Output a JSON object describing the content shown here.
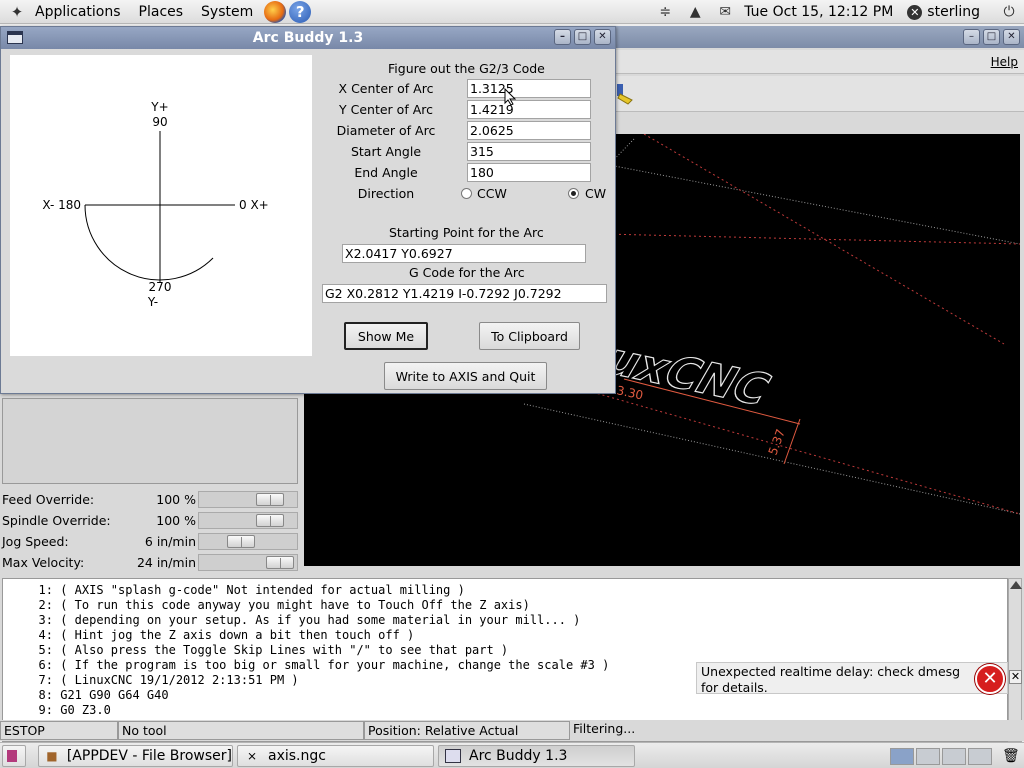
{
  "top_panel": {
    "menus": [
      "Applications",
      "Places",
      "System"
    ],
    "datetime": "Tue Oct 15, 12:12 PM",
    "user": "sterling"
  },
  "dialog": {
    "title": "Arc Buddy 1.3",
    "heading": "Figure out the G2/3 Code",
    "fields": [
      {
        "label": "X Center of Arc",
        "value": "1.3125"
      },
      {
        "label": "Y Center of Arc",
        "value": "1.4219"
      },
      {
        "label": "Diameter of Arc",
        "value": "2.0625"
      },
      {
        "label": "Start Angle",
        "value": "315"
      },
      {
        "label": "End Angle",
        "value": "180"
      }
    ],
    "direction_label": "Direction",
    "ccw_label": "CCW",
    "cw_label": "CW",
    "direction_selected": "CW",
    "starting_point_label": "Starting Point for the Arc",
    "starting_point_value": "X2.0417 Y0.6927",
    "gcode_label": "G Code for the Arc",
    "gcode_value": "G2 X0.2812 Y1.4219 I-0.7292 J0.7292",
    "show_me_label": "Show Me",
    "clipboard_label": "To Clipboard",
    "write_quit_label": "Write to AXIS and Quit",
    "canvas": {
      "y_plus": "Y+",
      "y_plus_angle": "90",
      "x_minus": "X- 180",
      "x_plus": "0 X+",
      "y_minus_angle": "270",
      "y_minus": "Y-",
      "arc_start_deg": 315,
      "arc_end_deg": 180
    }
  },
  "axis": {
    "help_menu": "Help",
    "preview_text": "LinuxCNC",
    "dim_labels": [
      "3.30",
      "5.37"
    ],
    "overrides": [
      {
        "label": "Feed Override:",
        "value": "100 %",
        "slider": 0.82
      },
      {
        "label": "Spindle Override:",
        "value": "100 %",
        "slider": 0.82
      },
      {
        "label": "Jog Speed:",
        "value": "6 in/min",
        "slider": 0.4
      },
      {
        "label": "Max Velocity:",
        "value": "24 in/min",
        "slider": 0.95
      }
    ],
    "code_lines": [
      {
        "num": "1:",
        "text": "( AXIS \"splash g-code\" Not intended for actual milling )"
      },
      {
        "num": "2:",
        "text": "( To run this code anyway you might have to Touch Off the Z axis)"
      },
      {
        "num": "3:",
        "text": "( depending on your setup. As if you had some material in your mill... )"
      },
      {
        "num": "4:",
        "text": "( Hint jog the Z axis down a bit then touch off )"
      },
      {
        "num": "5:",
        "text": "( Also press the Toggle Skip Lines with \"/\" to see that part )"
      },
      {
        "num": "6:",
        "text": "( If the program is too big or small for your machine, change the scale #3 )"
      },
      {
        "num": "7:",
        "text": "( LinuxCNC 19/1/2012 2:13:51 PM )"
      },
      {
        "num": "8:",
        "text": "G21 G90 G64 G40"
      },
      {
        "num": "9:",
        "text": "G0 Z3.0"
      }
    ],
    "notification": "Unexpected realtime delay: check dmesg for details.",
    "status": {
      "estop": "ESTOP",
      "tool": "No tool",
      "position": "Position: Relative Actual",
      "filter": "Filtering..."
    }
  },
  "taskbar": {
    "tasks": [
      "[APPDEV - File Browser]",
      "axis.ngc",
      "Arc Buddy 1.3"
    ]
  }
}
